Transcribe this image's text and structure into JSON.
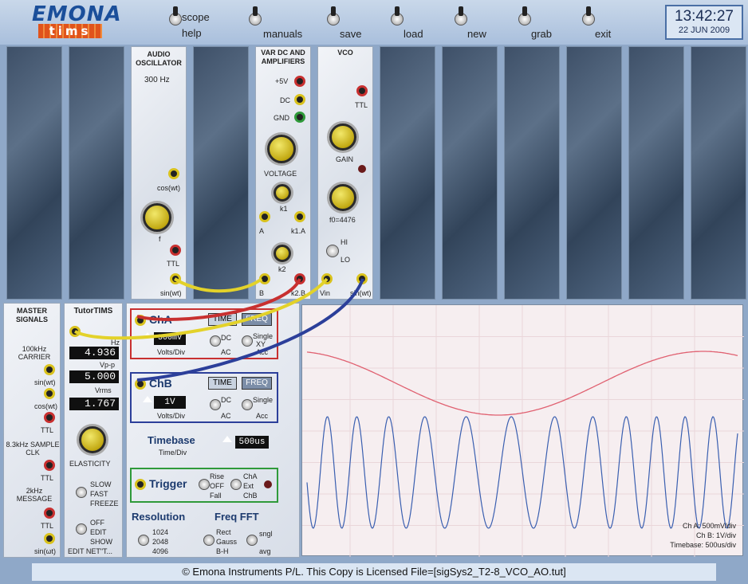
{
  "logo": {
    "top": "EMONA",
    "bottom": "tims"
  },
  "toolbar": [
    {
      "l1": "scope",
      "l2": "help"
    },
    {
      "l1": "",
      "l2": "manuals"
    },
    {
      "l1": "",
      "l2": "save"
    },
    {
      "l1": "",
      "l2": "load"
    },
    {
      "l1": "",
      "l2": "new"
    },
    {
      "l1": "",
      "l2": "grab"
    },
    {
      "l1": "",
      "l2": "exit"
    }
  ],
  "clock": {
    "time": "13:42:27",
    "date": "22 JUN 2009"
  },
  "audio_osc": {
    "title": "AUDIO OSCILLATOR",
    "freq": "300 Hz",
    "cos": "cos(wt)",
    "f": "f",
    "ttl": "TTL",
    "sin": "sin(wt)"
  },
  "var_dc": {
    "title": "VAR DC AND AMPLIFIERS",
    "p5v": "+5V",
    "dc": "DC",
    "gnd": "GND",
    "voltage": "VOLTAGE",
    "k1": "k1",
    "a": "A",
    "k1a": "k1.A",
    "k2": "k2",
    "b": "B",
    "k2b": "k2.B"
  },
  "vco": {
    "title": "VCO",
    "ttl": "TTL",
    "gain": "GAIN",
    "f0": "f0=4476",
    "hi": "HI",
    "lo": "LO",
    "vin": "Vin",
    "sin": "sin(wt)"
  },
  "master": {
    "title": "MASTER SIGNALS",
    "carrier": "100kHz CARRIER",
    "sin": "sin(wt)",
    "cos": "cos(wt)",
    "ttl": "TTL",
    "sample": "8.3kHz SAMPLE CLK",
    "ttl2": "TTL",
    "message": "2kHz MESSAGE",
    "ttl3": "TTL",
    "sin2": "sin(ωt)"
  },
  "tutor": {
    "title": "TutorTIMS",
    "hz_label": "Hz",
    "hz": "4.936",
    "vpp_label": "Vp-p",
    "vpp": "5.000",
    "vrms_label": "Vrms",
    "vrms": "1.767",
    "elasticity": "ELASTICITY",
    "slow": "SLOW",
    "fast": "FAST",
    "freeze": "FREEZE",
    "off": "OFF",
    "edit": "EDIT",
    "show": "SHOW",
    "editnet": "EDIT NET\"T..."
  },
  "cha": {
    "label": "ChA",
    "time": "TIME",
    "freq": "FREQ",
    "volts": "500mV",
    "volts_div": "Volts/Div",
    "dc": "DC",
    "ac": "AC",
    "single": "Single",
    "xy": "XY",
    "acc": "Acc"
  },
  "chb": {
    "label": "ChB",
    "time": "TIME",
    "freq": "FREQ",
    "volts": "1V",
    "volts_div": "Volts/Div",
    "dc": "DC",
    "ac": "AC",
    "single": "Single",
    "acc": "Acc"
  },
  "timebase": {
    "label": "Timebase",
    "sub": "Time/Div",
    "value": "500us"
  },
  "trigger": {
    "label": "Trigger",
    "rise": "Rise",
    "off": "OFF",
    "fall": "Fall",
    "cha": "ChA",
    "ext": "Ext",
    "chb": "ChB"
  },
  "resolution": {
    "label": "Resolution",
    "r1": "1024",
    "r2": "2048",
    "r3": "4096"
  },
  "fft": {
    "label": "Freq FFT",
    "rect": "Rect",
    "gauss": "Gauss",
    "bh": "B-H",
    "sngl": "sngl",
    "avg": "avg"
  },
  "scope_info": {
    "cha": "Ch A: 500mV/div",
    "chb": "Ch B: 1V/div",
    "tb": "Timebase: 500us/div"
  },
  "footer": "© Emona Instruments P/L. This Copy is Licensed    File=[sigSys2_T2-8_VCO_AO.tut]",
  "colors": {
    "cha_trace": "#e06070",
    "chb_trace": "#3a5fb0",
    "cha_box": "#c83030",
    "chb_box": "#2c3f9a",
    "trig_box": "#2f9a3a"
  }
}
